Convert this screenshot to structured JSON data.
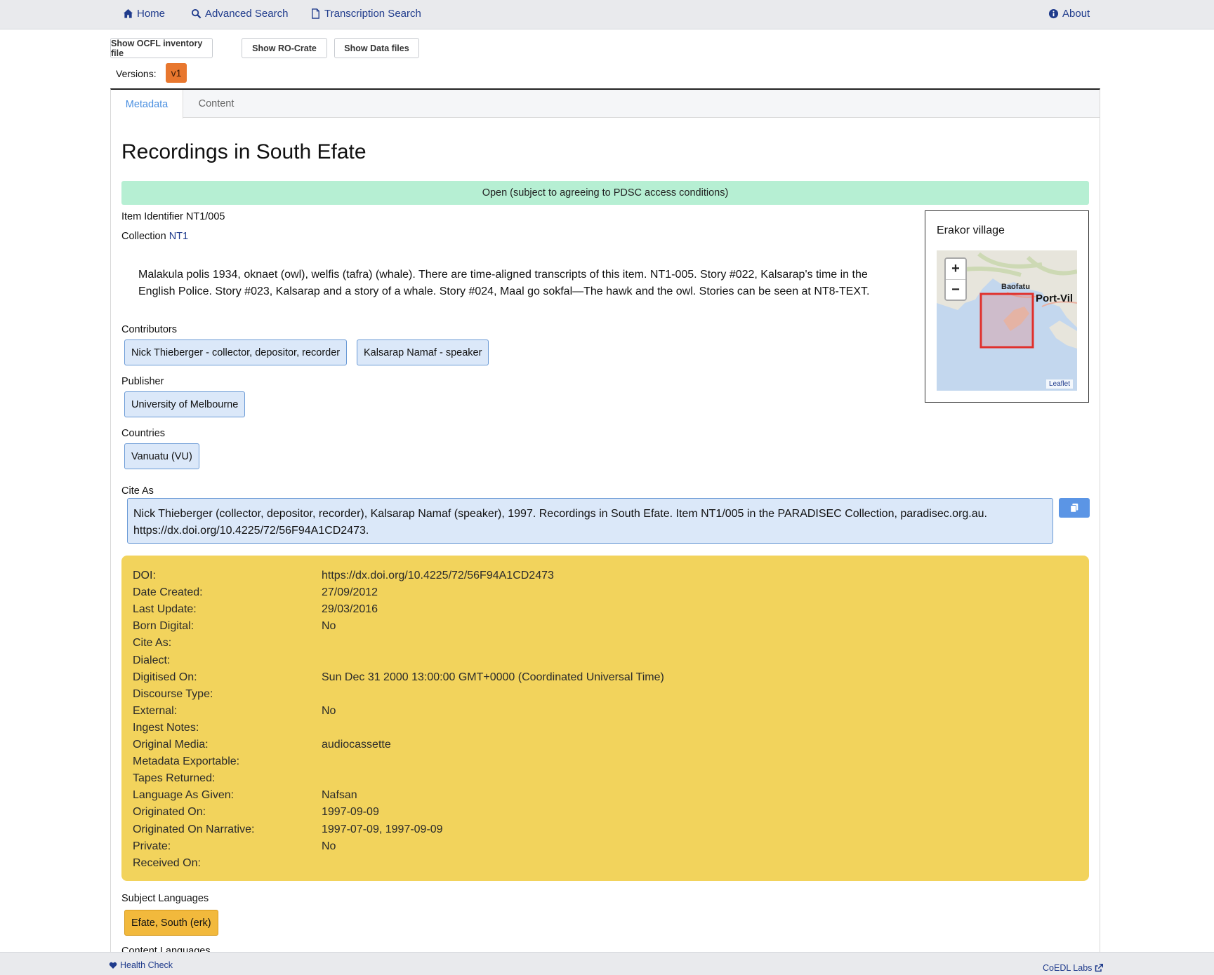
{
  "nav": {
    "home": "Home",
    "advanced_search": "Advanced Search",
    "transcription_search": "Transcription Search",
    "about": "About"
  },
  "toolbar": {
    "show_ocfl": "Show OCFL inventory file",
    "show_rocrate": "Show RO-Crate",
    "show_data_files": "Show Data files",
    "versions_label": "Versions:",
    "version": "v1"
  },
  "tabs": {
    "metadata": "Metadata",
    "content": "Content"
  },
  "item": {
    "title": "Recordings in South Efate",
    "access": "Open (subject to agreeing to PDSC access conditions)",
    "identifier_label": "Item Identifier",
    "identifier": "NT1/005",
    "collection_label": "Collection",
    "collection": "NT1",
    "description": "Malakula polis 1934, oknaet (owl), welfis (tafra) (whale). There are time-aligned transcripts of this item. NT1-005. Story #022, Kalsarap's time in the English Police. Story #023, Kalsarap and a story of a whale. Story #024, Maal go sokfal—The hawk and the owl. Stories can be seen at NT8-TEXT."
  },
  "contributors": {
    "label": "Contributors",
    "items": [
      "Nick Thieberger - collector, depositor, recorder",
      "Kalsarap Namaf - speaker"
    ]
  },
  "publisher": {
    "label": "Publisher",
    "items": [
      "University of Melbourne"
    ]
  },
  "countries": {
    "label": "Countries",
    "items": [
      "Vanuatu (VU)"
    ]
  },
  "map": {
    "title": "Erakor village",
    "zoom_in": "+",
    "zoom_out": "−",
    "place1": "Baofatu",
    "place2": "Port-Vil",
    "attribution": "Leaflet"
  },
  "cite": {
    "label": "Cite As",
    "text": "Nick Thieberger (collector, depositor, recorder), Kalsarap Namaf (speaker), 1997. Recordings in South Efate. Item NT1/005 in the PARADISEC Collection, paradisec.org.au. https://dx.doi.org/10.4225/72/56F94A1CD2473."
  },
  "details": [
    {
      "label": "DOI:",
      "value": "https://dx.doi.org/10.4225/72/56F94A1CD2473"
    },
    {
      "label": "Date Created:",
      "value": "27/09/2012"
    },
    {
      "label": "Last Update:",
      "value": "29/03/2016"
    },
    {
      "label": "Born Digital:",
      "value": "No"
    },
    {
      "label": "Cite As:",
      "value": ""
    },
    {
      "label": "Dialect:",
      "value": ""
    },
    {
      "label": "Digitised On:",
      "value": "Sun Dec 31 2000 13:00:00 GMT+0000 (Coordinated Universal Time)"
    },
    {
      "label": "Discourse Type:",
      "value": ""
    },
    {
      "label": "External:",
      "value": "No"
    },
    {
      "label": "Ingest Notes:",
      "value": ""
    },
    {
      "label": "Original Media:",
      "value": "audiocassette"
    },
    {
      "label": "Metadata Exportable:",
      "value": ""
    },
    {
      "label": "Tapes Returned:",
      "value": ""
    },
    {
      "label": "Language As Given:",
      "value": "Nafsan"
    },
    {
      "label": "Originated On:",
      "value": "1997-09-09"
    },
    {
      "label": "Originated On Narrative:",
      "value": "1997-07-09, 1997-09-09"
    },
    {
      "label": "Private:",
      "value": "No"
    },
    {
      "label": "Received On:",
      "value": ""
    }
  ],
  "subject_languages": {
    "label": "Subject Languages",
    "items": [
      "Efate, South (erk)"
    ]
  },
  "content_languages": {
    "label": "Content Languages"
  },
  "footer": {
    "health_check": "Health Check",
    "coedl": "CoEDL Labs"
  },
  "colors": {
    "access_bg": "#b6efd3",
    "details_bg": "#f2d35c",
    "chip_bg": "#dbe8f9",
    "version_badge": "#e8772e",
    "link": "#1f3b8c"
  }
}
